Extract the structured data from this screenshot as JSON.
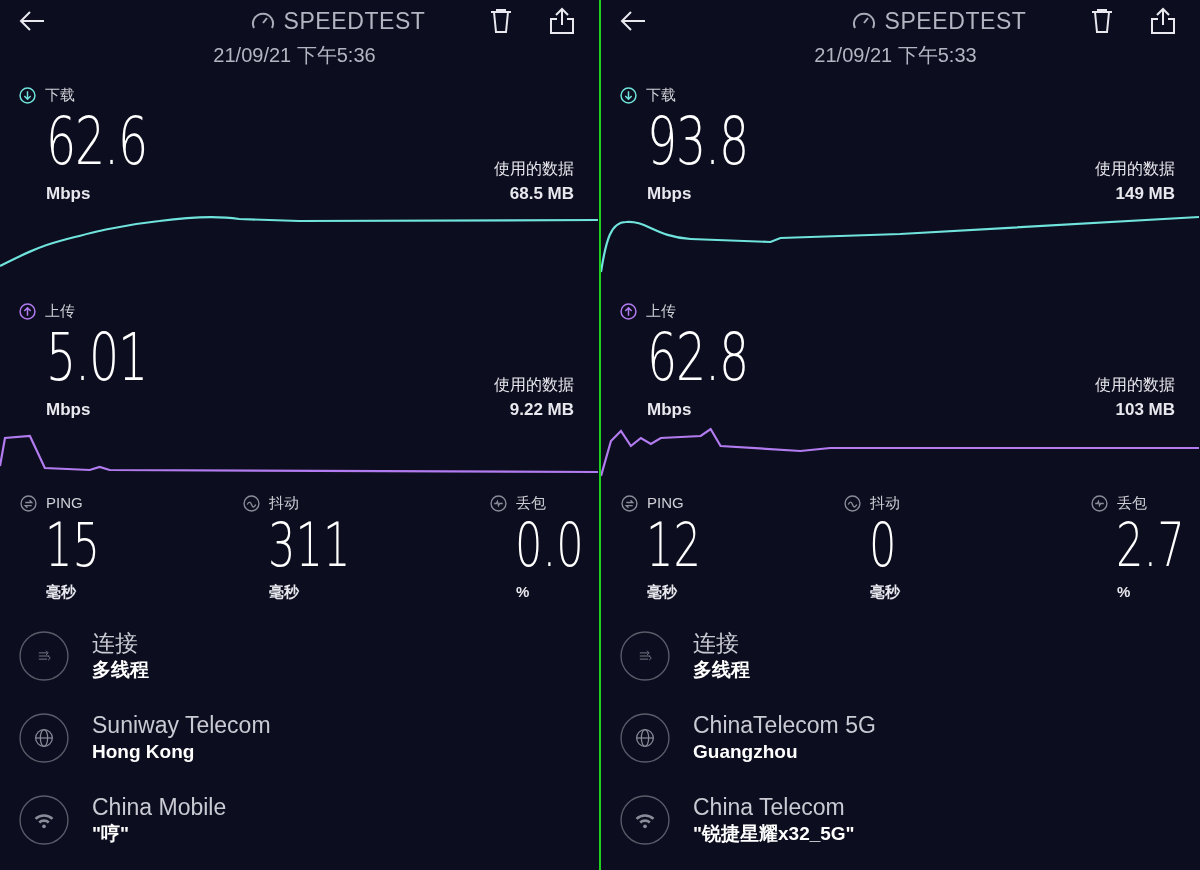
{
  "panels": [
    {
      "title": "SPEEDTEST",
      "date": "21/09/21 下午5:36",
      "download": {
        "label": "下载",
        "value": "62.6",
        "unit": "Mbps",
        "data_label": "使用的数据",
        "data_value": "68.5 MB"
      },
      "upload": {
        "label": "上传",
        "value": "5.01",
        "unit": "Mbps",
        "data_label": "使用的数据",
        "data_value": "9.22 MB"
      },
      "metrics": [
        {
          "kind": "ping",
          "label": "PING",
          "value": "15",
          "unit": "毫秒"
        },
        {
          "kind": "jitter",
          "label": "抖动",
          "value": "311",
          "unit": "毫秒"
        },
        {
          "kind": "loss",
          "label": "丢包",
          "value": "0.0",
          "unit": "%"
        }
      ],
      "details": [
        {
          "kind": "connections",
          "title": "连接",
          "subtitle": "多线程"
        },
        {
          "kind": "server",
          "title": "Suniway Telecom",
          "subtitle": "Hong Kong"
        },
        {
          "kind": "network",
          "title": "China Mobile",
          "subtitle": "\"哼\""
        }
      ]
    },
    {
      "title": "SPEEDTEST",
      "date": "21/09/21 下午5:33",
      "download": {
        "label": "下载",
        "value": "93.8",
        "unit": "Mbps",
        "data_label": "使用的数据",
        "data_value": "149 MB"
      },
      "upload": {
        "label": "上传",
        "value": "62.8",
        "unit": "Mbps",
        "data_label": "使用的数据",
        "data_value": "103 MB"
      },
      "metrics": [
        {
          "kind": "ping",
          "label": "PING",
          "value": "12",
          "unit": "毫秒"
        },
        {
          "kind": "jitter",
          "label": "抖动",
          "value": "0",
          "unit": "毫秒"
        },
        {
          "kind": "loss",
          "label": "丢包",
          "value": "2.7",
          "unit": "%"
        }
      ],
      "details": [
        {
          "kind": "connections",
          "title": "连接",
          "subtitle": "多线程"
        },
        {
          "kind": "server",
          "title": "ChinaTelecom 5G",
          "subtitle": "Guangzhou"
        },
        {
          "kind": "network",
          "title": "China Telecom",
          "subtitle": "\"锐捷星耀x32_5G\""
        }
      ]
    }
  ]
}
